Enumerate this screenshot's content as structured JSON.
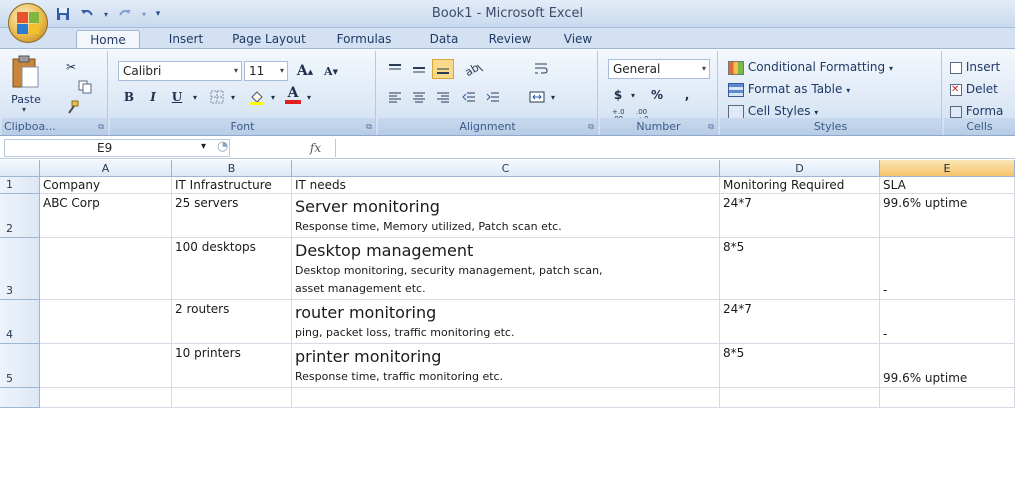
{
  "window": {
    "title": "Book1 - Microsoft Excel"
  },
  "quick_access": {
    "save_icon": "save-icon",
    "undo_icon": "undo-icon",
    "redo_icon": "redo-icon",
    "customize_icon": "customize-qat-icon"
  },
  "ribbon": {
    "tabs": [
      "Home",
      "Insert",
      "Page Layout",
      "Formulas",
      "Data",
      "Review",
      "View"
    ],
    "active_tab": "Home",
    "clipboard": {
      "paste_label": "Paste",
      "group_label": "Clipboa..."
    },
    "font": {
      "font_name": "Calibri",
      "font_size": "11",
      "group_label": "Font",
      "bold": "B",
      "italic": "I",
      "underline": "U",
      "grow": "A",
      "shrink": "A",
      "color_letter": "A"
    },
    "alignment": {
      "group_label": "Alignment"
    },
    "number": {
      "format": "General",
      "currency": "$",
      "percent": "%",
      "comma": ",",
      "inc_decimal": "+.0 .00",
      "dec_decimal": ".00 +.0",
      "group_label": "Number"
    },
    "styles": {
      "conditional": "Conditional Formatting",
      "format_table": "Format as Table",
      "cell_styles": "Cell Styles",
      "group_label": "Styles"
    },
    "cells": {
      "insert": "Insert",
      "delete": "Delet",
      "format": "Forma",
      "group_label": "Cells"
    }
  },
  "formula_bar": {
    "name_box": "E9",
    "fx_label": "fx",
    "formula_value": ""
  },
  "sheet": {
    "columns": [
      "A",
      "B",
      "C",
      "D",
      "E"
    ],
    "selected_column": "E",
    "rows": [
      {
        "num": "1",
        "a": "Company",
        "b": "IT Infrastructure",
        "c_title": "IT needs",
        "c_desc": "",
        "d": "Monitoring Required",
        "e": "SLA"
      },
      {
        "num": "2",
        "a": "ABC Corp",
        "b": "25 servers",
        "c_title": "Server monitoring",
        "c_desc": "Response time, Memory utilized, Patch scan etc.",
        "d": "24*7",
        "e": "99.6% uptime"
      },
      {
        "num": "3",
        "a": "",
        "b": "100 desktops",
        "c_title": "Desktop management",
        "c_desc": "Desktop monitoring, security management, patch scan,",
        "c_desc2": "asset management etc.",
        "d": "8*5",
        "e": "-"
      },
      {
        "num": "4",
        "a": "",
        "b": "2 routers",
        "c_title": "router monitoring",
        "c_desc": "ping, packet loss, traffic monitoring etc.",
        "d": "24*7",
        "e": "-"
      },
      {
        "num": "5",
        "a": "",
        "b": "10 printers",
        "c_title": "printer monitoring",
        "c_desc": "Response time, traffic monitoring etc.",
        "d": "8*5",
        "e": "99.6% uptime"
      }
    ]
  }
}
